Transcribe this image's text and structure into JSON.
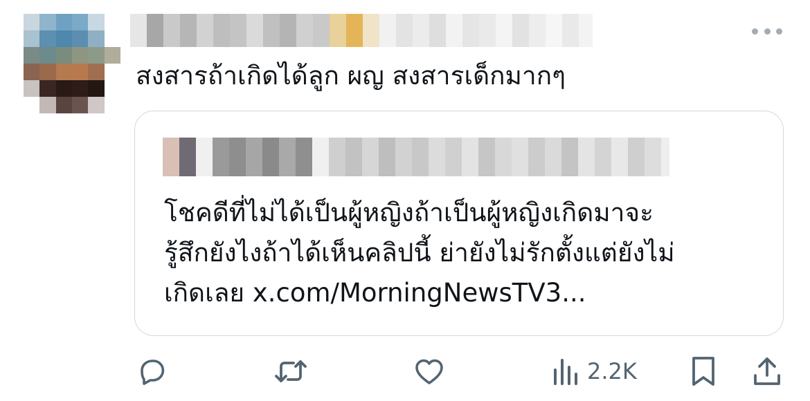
{
  "post": {
    "text": "สงสารถ้าเกิดได้ลูก ผญ สงสารเด็กมากๆ",
    "quoted": {
      "lines": [
        "โชคดีที่ไม่ได้เป็นผู้หญิงถ้าเป็นผู้หญิงเกิดมาจะ",
        "รู้สึกยังไงถ้าได้เห็นคลิปนี้ ย่ายังไม่รักตั้งแต่ยังไม่",
        "เกิดเลย x.com/MorningNewsTV3..."
      ]
    }
  },
  "actions": {
    "views_count": "2.2K"
  },
  "icons": {
    "more": "more-horizontal-icon",
    "reply": "reply-icon",
    "repost": "repost-icon",
    "like": "heart-icon",
    "views": "views-chart-icon",
    "bookmark": "bookmark-icon",
    "share": "share-icon"
  },
  "colors": {
    "text": "#0f1419",
    "secondary": "#536471",
    "border": "#cfd9de",
    "icon": "#536471"
  }
}
